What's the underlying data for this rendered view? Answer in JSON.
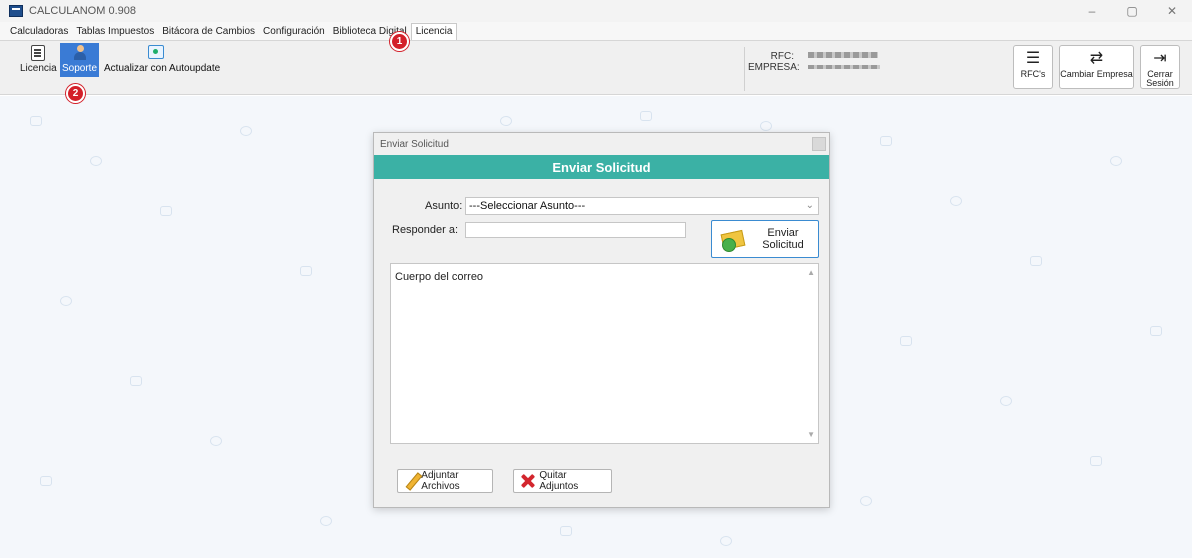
{
  "window": {
    "title": "CALCULANOM 0.908",
    "controls": [
      "–",
      "▢",
      "✕"
    ]
  },
  "menu": {
    "items": [
      "Calculadoras",
      "Tablas Impuestos",
      "Bitácora de Cambios",
      "Configuración",
      "Biblioteca Digital",
      "Licencia"
    ],
    "active": "Licencia"
  },
  "ribbon": {
    "licencia_label": "Licencia",
    "soporte_label": "Soporte",
    "autoupdate_label": "Actualizar con Autoupdate",
    "rfc_label": "RFC:",
    "empresa_label": "EMPRESA:",
    "rfcs_label": "RFC's",
    "cambiar_empresa_label": "Cambiar Empresa",
    "cerrar_sesion_label": "Cerrar Sesión"
  },
  "badges": {
    "one": "1",
    "two": "2"
  },
  "dialog": {
    "window_title": "Enviar Solicitud",
    "header": "Enviar Solicitud",
    "asunto_label": "Asunto:",
    "asunto_value": "---Seleccionar Asunto---",
    "responder_label": "Responder a:",
    "responder_value": "",
    "send_button": "Enviar Solicitud",
    "body_text": "Cuerpo del correo",
    "attach_button": "Adjuntar Archivos",
    "remove_button": "Quitar Adjuntos"
  },
  "colors": {
    "header_teal": "#3bb1a5",
    "badge_red": "#d3202a",
    "ribbon_selected": "#3a7bd5"
  }
}
